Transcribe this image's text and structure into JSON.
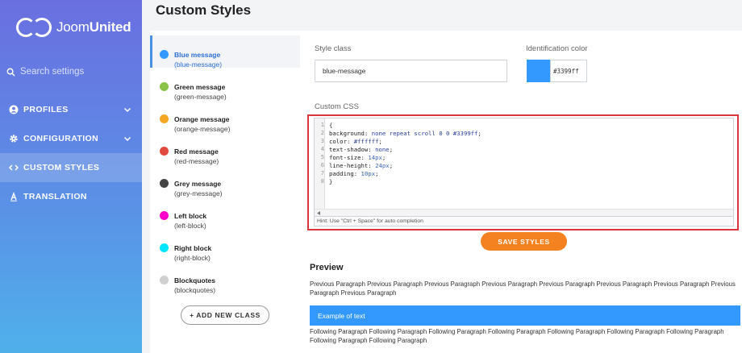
{
  "brand": {
    "name_light": "Joom",
    "name_bold": "United"
  },
  "sidebar": {
    "search_placeholder": "Search settings",
    "items": [
      {
        "label": "PROFILES",
        "icon": "user-circle-icon",
        "has_chevron": true
      },
      {
        "label": "CONFIGURATION",
        "icon": "gear-icon",
        "has_chevron": true
      },
      {
        "label": "CUSTOM STYLES",
        "icon": "code-icon",
        "has_chevron": false,
        "active": true
      },
      {
        "label": "TRANSLATION",
        "icon": "translate-icon",
        "has_chevron": false
      }
    ]
  },
  "page": {
    "title": "Custom Styles"
  },
  "classes": [
    {
      "name": "Blue message",
      "slug": "(blue-message)",
      "color": "#3399ff",
      "active": true
    },
    {
      "name": "Green message",
      "slug": "(green-message)",
      "color": "#8bc34a"
    },
    {
      "name": "Orange message",
      "slug": "(orange-message)",
      "color": "#f5a623"
    },
    {
      "name": "Red message",
      "slug": "(red-message)",
      "color": "#e04a3f"
    },
    {
      "name": "Grey message",
      "slug": "(grey-message)",
      "color": "#444444"
    },
    {
      "name": "Left block",
      "slug": "(left-block)",
      "color": "#ff00cc"
    },
    {
      "name": "Right block",
      "slug": "(right-block)",
      "color": "#00e5ff"
    },
    {
      "name": "Blockquotes",
      "slug": "(blockquotes)",
      "color": "#d0d0d0"
    }
  ],
  "add_class_label": "+ ADD NEW CLASS",
  "editor": {
    "style_class_label": "Style class",
    "style_class_value": "blue-message",
    "identification_color_label": "Identification color",
    "identification_color_value": "#3399ff",
    "custom_css_label": "Custom CSS",
    "code_lines": [
      {
        "n": "1",
        "text": "{"
      },
      {
        "n": "2",
        "prop": "background: ",
        "val": "none repeat scroll 0 0 #3399ff",
        "end": ";"
      },
      {
        "n": "3",
        "prop": "color: ",
        "val": "#ffffff",
        "end": ";"
      },
      {
        "n": "4",
        "prop": "text-shadow: ",
        "val": "none",
        "end": ";"
      },
      {
        "n": "5",
        "prop": "font-size: ",
        "val": "14px",
        "end": ";"
      },
      {
        "n": "6",
        "prop": "line-height: ",
        "val": "24px",
        "end": ";"
      },
      {
        "n": "7",
        "prop": "padding: ",
        "val": "10px",
        "end": ";"
      },
      {
        "n": "8",
        "text": "}"
      }
    ],
    "hint": "Hint: Use \"Ctrl + Space\" for auto completion",
    "save_label": "SAVE STYLES"
  },
  "preview": {
    "title": "Preview",
    "previous_text": "Previous Paragraph Previous Paragraph Previous Paragraph Previous Paragraph Previous Paragraph Previous Paragraph Previous Paragraph Previous Paragraph Previous Paragraph",
    "example_text": "Example of text",
    "following_text": "Following Paragraph Following Paragraph Following Paragraph Following Paragraph Following Paragraph Following Paragraph Following Paragraph Following Paragraph Following Paragraph"
  }
}
